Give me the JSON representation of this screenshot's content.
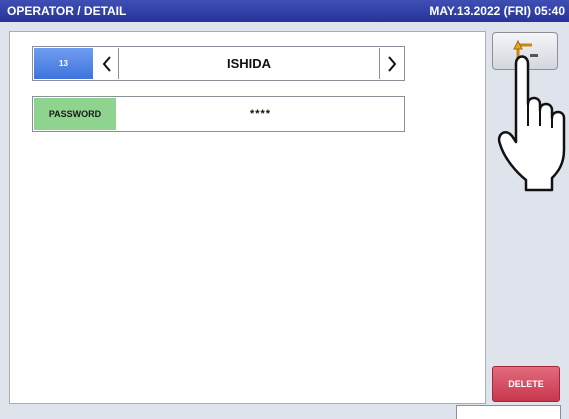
{
  "header": {
    "title": "OPERATOR / DETAIL",
    "datetime": "MAY.13.2022 (FRI) 05:40"
  },
  "operator": {
    "code": "13",
    "name": "ISHIDA",
    "prev_icon": "chevron-left-icon",
    "next_icon": "chevron-right-icon"
  },
  "password": {
    "label": "PASSWORD",
    "value": "****"
  },
  "buttons": {
    "back_icon": "return-arrow-icon",
    "delete_label": "DELETE"
  },
  "colors": {
    "title_bar": "#2f3ea6",
    "code_badge": "#4a7fe0",
    "password_label": "#8ed48e",
    "delete_button": "#d4465a",
    "background": "#dfe4ec"
  }
}
